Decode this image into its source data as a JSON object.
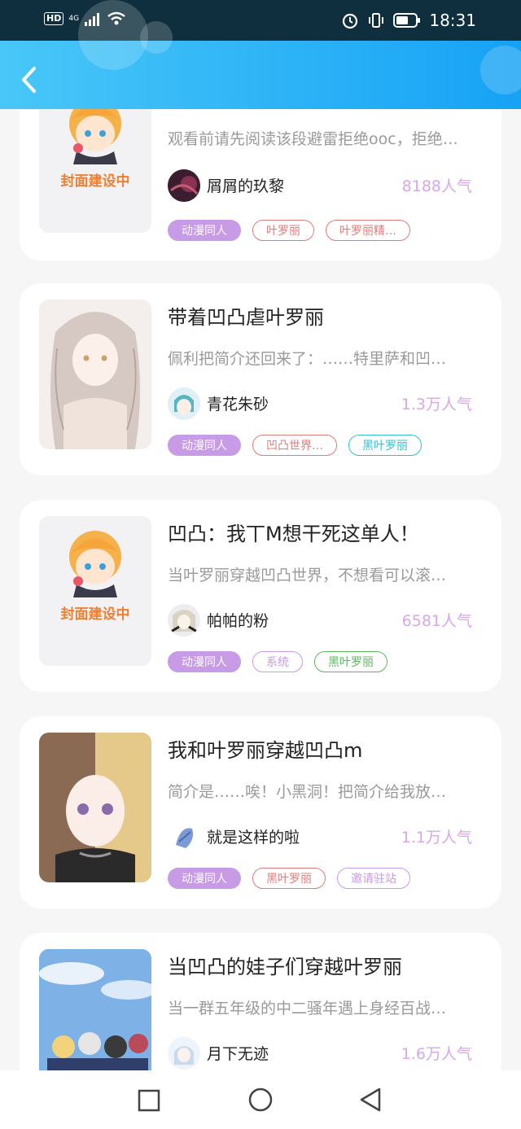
{
  "status": {
    "time": "18:31",
    "hd": "HD",
    "network": "4G"
  },
  "header": {
    "back_icon": "chevron-left-icon"
  },
  "cards": [
    {
      "title": "",
      "desc": "观看前请先阅读该段避雷拒绝ooc，拒绝…",
      "author": "屑屑的玖黎",
      "popularity": "8188人气",
      "cover_text": "封面建设中",
      "tags": [
        {
          "label": "动漫同人",
          "color": "#c89be6",
          "filled": true
        },
        {
          "label": "叶罗丽",
          "color": "#e27a7a",
          "filled": false
        },
        {
          "label": "叶罗丽精…",
          "color": "#e27a7a",
          "filled": false
        }
      ]
    },
    {
      "title": "带着凹凸虐叶罗丽",
      "desc": "佩利把简介还回来了：……特里萨和凹…",
      "author": "青花朱砂",
      "popularity": "1.3万人气",
      "cover_text": "",
      "tags": [
        {
          "label": "动漫同人",
          "color": "#c89be6",
          "filled": true
        },
        {
          "label": "凹凸世界…",
          "color": "#e27a7a",
          "filled": false
        },
        {
          "label": "黑叶罗丽",
          "color": "#31bfd6",
          "filled": false
        }
      ]
    },
    {
      "title": "凹凸：我丅M想干死这单人！",
      "desc": "当叶罗丽穿越凹凸世界，不想看可以滚…",
      "author": "帕帕的粉",
      "popularity": "6581人气",
      "cover_text": "封面建设中",
      "tags": [
        {
          "label": "动漫同人",
          "color": "#c89be6",
          "filled": true
        },
        {
          "label": "系统",
          "color": "#c89be6",
          "filled": false
        },
        {
          "label": "黑叶罗丽",
          "color": "#5cb85c",
          "filled": false
        }
      ]
    },
    {
      "title": "我和叶罗丽穿越凹凸m",
      "desc": "简介是……唉！小黑洞！把简介给我放…",
      "author": "就是这样的啦",
      "popularity": "1.1万人气",
      "cover_text": "",
      "tags": [
        {
          "label": "动漫同人",
          "color": "#c89be6",
          "filled": true
        },
        {
          "label": "黑叶罗丽",
          "color": "#e27a7a",
          "filled": false
        },
        {
          "label": "邀请驻站",
          "color": "#c89be6",
          "filled": false
        }
      ]
    },
    {
      "title": "当凹凸的娃子们穿越叶罗丽",
      "desc": "当一群五年级的中二骚年遇上身经百战…",
      "author": "月下无迹",
      "popularity": "1.6万人气",
      "cover_text": "",
      "tags": []
    }
  ],
  "navbar": {
    "items": [
      "square-icon",
      "circle-icon",
      "triangle-back-icon"
    ]
  }
}
